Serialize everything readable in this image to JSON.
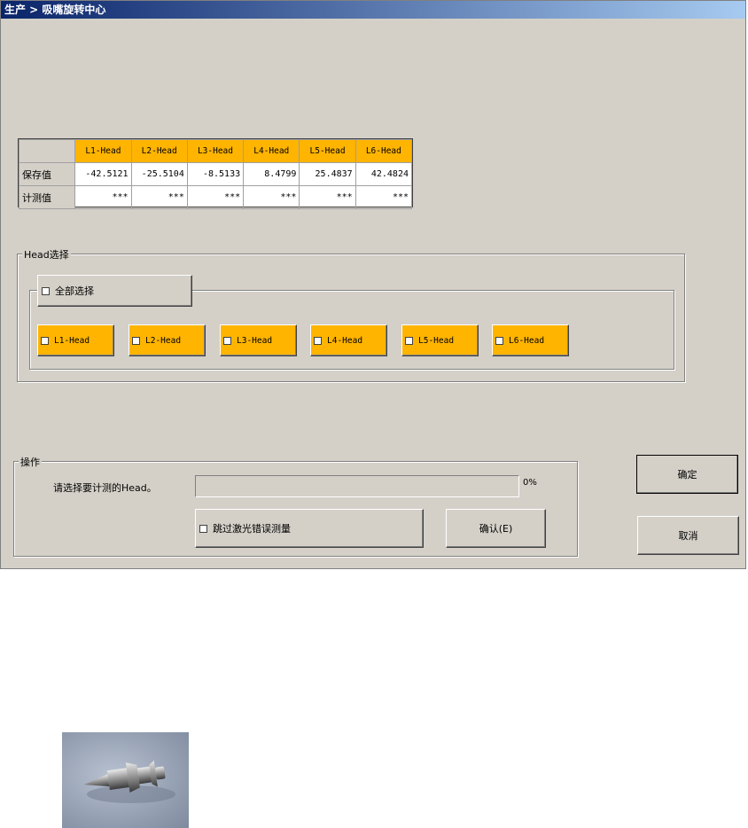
{
  "window": {
    "title": "生产 > 吸嘴旋转中心"
  },
  "grid": {
    "headers": [
      "L1-Head",
      "L2-Head",
      "L3-Head",
      "L4-Head",
      "L5-Head",
      "L6-Head"
    ],
    "rows": [
      {
        "label": "保存值",
        "values": [
          "-42.5121",
          "-25.5104",
          "-8.5133",
          "8.4799",
          "25.4837",
          "42.4824"
        ]
      },
      {
        "label": "计测值",
        "values": [
          "***",
          "***",
          "***",
          "***",
          "***",
          "***"
        ]
      }
    ]
  },
  "head_select": {
    "group_label": "Head选择",
    "select_all_label": "全部选择",
    "heads": [
      "L1-Head",
      "L2-Head",
      "L3-Head",
      "L4-Head",
      "L5-Head",
      "L6-Head"
    ]
  },
  "operation": {
    "group_label": "操作",
    "status_text": "请选择要计测的Head。",
    "progress_text": "0%",
    "progress_value": 0,
    "skip_label": "跳过激光错误测量",
    "confirm_label": "确认(E)"
  },
  "buttons": {
    "ok_label": "确定",
    "cancel_label": "取消"
  },
  "colors": {
    "title_bar": "#0a246a",
    "head_orange": "#ffb400",
    "window_bg": "#d4d0c8"
  },
  "photo": {
    "subject": "nozzle-image"
  }
}
